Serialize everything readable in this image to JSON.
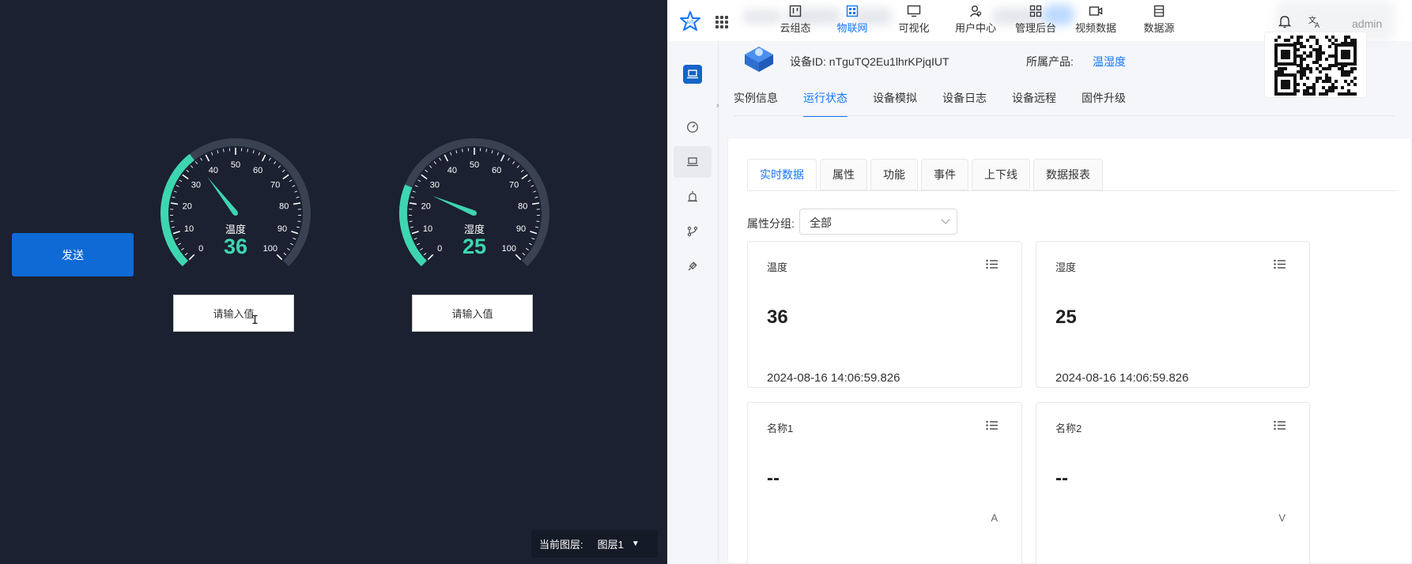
{
  "left": {
    "send_button": "发送",
    "gauges": [
      {
        "label": "温度",
        "value": 36
      },
      {
        "label": "湿度",
        "value": 25
      }
    ],
    "gauge_ticks": [
      "0",
      "10",
      "20",
      "30",
      "40",
      "50",
      "60",
      "70",
      "80",
      "90",
      "100"
    ],
    "input_placeholder": "请输入值",
    "layer": {
      "label": "当前图层:",
      "value": "图层1"
    }
  },
  "right": {
    "nav": [
      {
        "label": "云组态",
        "icon": "kanban-icon"
      },
      {
        "label": "物联网",
        "icon": "iot-icon",
        "active": true
      },
      {
        "label": "可视化",
        "icon": "monitor-icon"
      },
      {
        "label": "用户中心",
        "icon": "user-icon"
      },
      {
        "label": "管理后台",
        "icon": "grid-icon"
      },
      {
        "label": "视频数据",
        "icon": "video-icon"
      },
      {
        "label": "数据源",
        "icon": "database-icon"
      }
    ],
    "user": "admin",
    "device": {
      "id_text": "设备ID: nTguTQ2Eu1lhrKPjqIUT",
      "product_label": "所属产品:",
      "product_value": "温湿度"
    },
    "tabs": [
      {
        "label": "实例信息"
      },
      {
        "label": "运行状态",
        "active": true
      },
      {
        "label": "设备模拟"
      },
      {
        "label": "设备日志"
      },
      {
        "label": "设备远程"
      },
      {
        "label": "固件升级"
      }
    ],
    "subtabs": [
      {
        "label": "实时数据",
        "active": true
      },
      {
        "label": "属性"
      },
      {
        "label": "功能"
      },
      {
        "label": "事件"
      },
      {
        "label": "上下线"
      },
      {
        "label": "数据报表"
      }
    ],
    "group": {
      "label": "属性分组:",
      "value": "全部"
    },
    "cards": [
      {
        "title": "温度",
        "value": "36",
        "time": "2024-08-16 14:06:59.826",
        "unit": ""
      },
      {
        "title": "湿度",
        "value": "25",
        "time": "2024-08-16 14:06:59.826",
        "unit": ""
      },
      {
        "title": "名称1",
        "value": "--",
        "time": "",
        "unit": "A"
      },
      {
        "title": "名称2",
        "value": "--",
        "time": "",
        "unit": "V"
      }
    ]
  },
  "colors": {
    "accent": "#1677ff",
    "gauge_green": "#3ed6b0",
    "dark_bg": "#1b2130",
    "send_blue": "#0f6ad6"
  }
}
